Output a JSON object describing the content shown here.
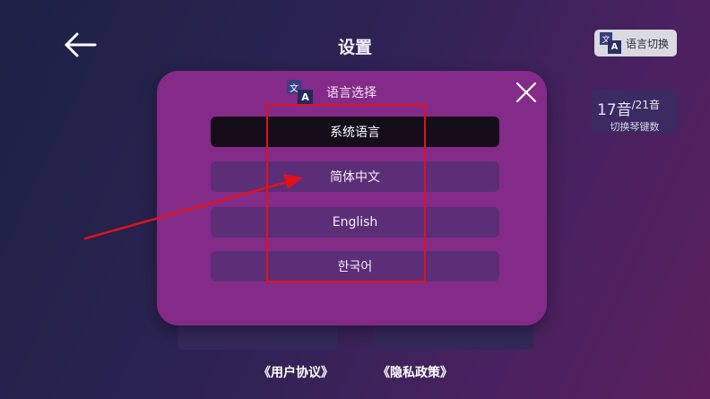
{
  "header": {
    "title": "设置",
    "back_icon": "arrow-left-icon"
  },
  "language_switch": {
    "label": "语言切换",
    "icon": "translate-icon",
    "icon_glyph_back": "文",
    "icon_glyph_front": "A"
  },
  "key_count": {
    "main": "17音",
    "alt": "/21音",
    "label": "切换琴键数"
  },
  "footer": {
    "user_agreement": "《用户协议》",
    "privacy_policy": "《隐私政策》"
  },
  "modal": {
    "title": "语言选择",
    "icon": "translate-icon",
    "icon_glyph_back": "文",
    "icon_glyph_front": "A",
    "close_icon": "close-icon",
    "options": [
      {
        "label": "系统语言",
        "selected": true
      },
      {
        "label": "简体中文",
        "selected": false
      },
      {
        "label": "English",
        "selected": false
      },
      {
        "label": "한국어",
        "selected": false
      }
    ]
  },
  "annotations": {
    "highlight_color": "#e0121b"
  },
  "colors": {
    "modal_bg": "#842a88",
    "option_bg": "#5c2e77",
    "option_selected_bg": "#150d1a"
  }
}
